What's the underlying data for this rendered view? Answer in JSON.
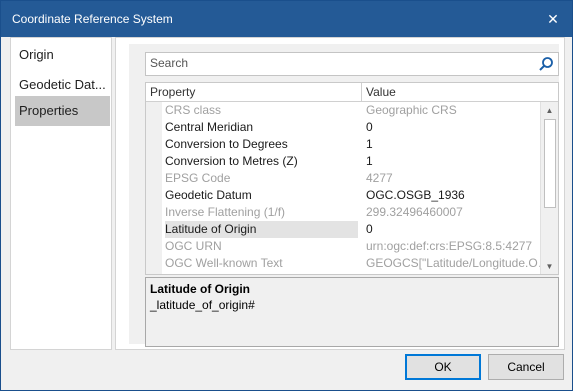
{
  "window": {
    "title": "Coordinate Reference System"
  },
  "nav": {
    "items": [
      {
        "label": "Origin"
      },
      {
        "label": "Geodetic Dat..."
      },
      {
        "label": "Properties"
      }
    ]
  },
  "search": {
    "placeholder": "Search"
  },
  "grid": {
    "columns": [
      "Property",
      "Value"
    ],
    "rows": [
      {
        "name": "CRS class",
        "value": "Geographic CRS",
        "readonly": true
      },
      {
        "name": "Central Meridian",
        "value": "0",
        "readonly": false
      },
      {
        "name": "Conversion to Degrees",
        "value": "1",
        "readonly": false
      },
      {
        "name": "Conversion to Metres (Z)",
        "value": "1",
        "readonly": false
      },
      {
        "name": "EPSG Code",
        "value": "4277",
        "readonly": true
      },
      {
        "name": "Geodetic Datum",
        "value": "OGC.OSGB_1936",
        "readonly": false
      },
      {
        "name": "Inverse Flattening (1/f)",
        "value": "299.32496460007",
        "readonly": true
      },
      {
        "name": "Latitude of Origin",
        "value": "0",
        "readonly": false,
        "selected": true
      },
      {
        "name": "OGC URN",
        "value": "urn:ogc:def:crs:EPSG:8.5:4277",
        "readonly": true
      },
      {
        "name": "OGC Well-known Text",
        "value": "GEOGCS[\"Latitude/Longitude.OGC....",
        "readonly": true
      }
    ]
  },
  "description": {
    "name": "Latitude of Origin",
    "text": "_latitude_of_origin#"
  },
  "buttons": {
    "ok": "OK",
    "cancel": "Cancel"
  }
}
